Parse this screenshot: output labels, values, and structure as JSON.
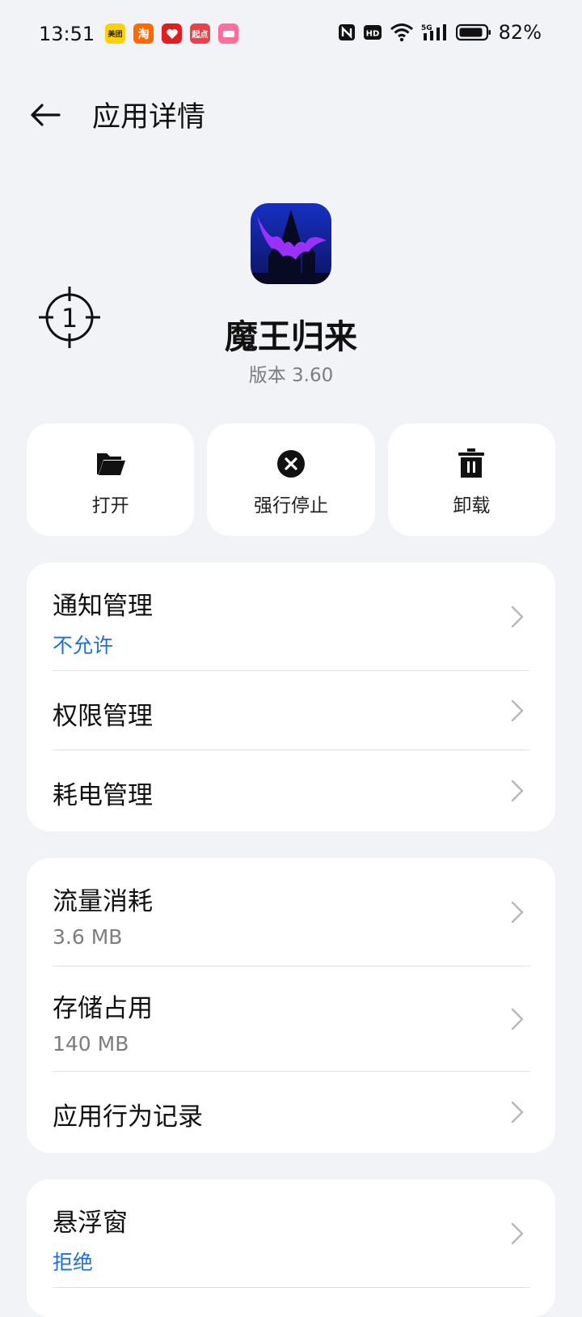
{
  "status_bar": {
    "time": "13:51",
    "notifications": [
      {
        "icon": "meituan-icon",
        "label": "美团",
        "color": "#ffd100",
        "text_color": "#222222"
      },
      {
        "icon": "taobao-icon",
        "label": "淘",
        "color": "#ff6a00",
        "text_color": "#ffffff"
      },
      {
        "icon": "red-app-icon",
        "label": "",
        "color": "#e02020",
        "text_color": "#ffffff"
      },
      {
        "icon": "qidian-icon",
        "label": "起点",
        "color": "#e8434a",
        "text_color": "#ffffff"
      },
      {
        "icon": "pink-app-icon",
        "label": "",
        "color": "#ff6e9a",
        "text_color": "#ffffff"
      }
    ],
    "battery": "82%"
  },
  "header": {
    "title": "应用详情"
  },
  "app": {
    "name": "魔王归来",
    "version": "版本 3.60",
    "icon": "castle-bat-app-icon",
    "icon_color": "#1e2ca8",
    "bat_color": "#9b30ff"
  },
  "marker": {
    "number": "1"
  },
  "actions": [
    {
      "label": "打开",
      "icon": "folder-icon"
    },
    {
      "label": "强行停止",
      "icon": "stop-icon"
    },
    {
      "label": "卸载",
      "icon": "trash-icon"
    }
  ],
  "card1": [
    {
      "title": "通知管理",
      "sub": "不允许"
    },
    {
      "title": "权限管理"
    },
    {
      "title": "耗电管理"
    }
  ],
  "card2": [
    {
      "title": "流量消耗",
      "sub": "3.6 MB"
    },
    {
      "title": "存储占用",
      "sub": "140 MB"
    },
    {
      "title": "应用行为记录"
    }
  ],
  "card3": [
    {
      "title": "悬浮窗",
      "sub": "拒绝"
    }
  ],
  "colors": {
    "accent": "#1f6fe0",
    "background": "#f2f3f7",
    "card": "#ffffff",
    "secondary_text": "#7d7d7d"
  }
}
